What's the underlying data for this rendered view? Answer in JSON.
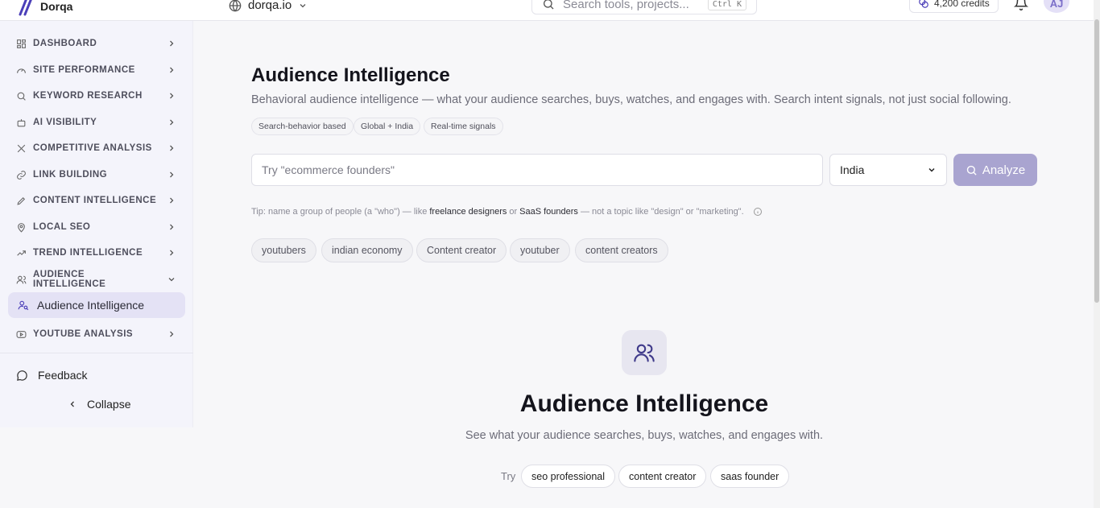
{
  "header": {
    "brand": "Dorqa",
    "site": "dorqa.io",
    "search_placeholder": "Search tools, projects...",
    "search_shortcut": "Ctrl K",
    "credits": "4,200 credits",
    "avatar_initials": "AJ"
  },
  "sidebar": {
    "items": [
      {
        "label": "DASHBOARD",
        "icon": "grid-icon"
      },
      {
        "label": "SITE PERFORMANCE",
        "icon": "gauge-icon"
      },
      {
        "label": "KEYWORD RESEARCH",
        "icon": "search-icon"
      },
      {
        "label": "AI VISIBILITY",
        "icon": "robot-icon"
      },
      {
        "label": "COMPETITIVE ANALYSIS",
        "icon": "swords-icon"
      },
      {
        "label": "LINK BUILDING",
        "icon": "link-icon"
      },
      {
        "label": "CONTENT INTELLIGENCE",
        "icon": "pen-icon"
      },
      {
        "label": "LOCAL SEO",
        "icon": "map-pin-icon"
      },
      {
        "label": "TREND INTELLIGENCE",
        "icon": "trending-up-icon"
      },
      {
        "label": "AUDIENCE INTELLIGENCE",
        "icon": "users-icon"
      },
      {
        "label": "YOUTUBE ANALYSIS",
        "icon": "youtube-icon"
      }
    ],
    "active_sub": "Audience Intelligence",
    "feedback": "Feedback",
    "collapse": "Collapse"
  },
  "main": {
    "title": "Audience Intelligence",
    "subtitle": "Behavioral audience intelligence — what your audience searches, buys, watches, and engages with. Search intent signals, not just social following.",
    "chips": [
      "Search-behavior based",
      "Global + India",
      "Real-time signals"
    ],
    "query_placeholder": "Try \"ecommerce founders\"",
    "country": "India",
    "analyze_label": "Analyze",
    "tip": {
      "p1": "Tip: name a group of people (a \"who\") — like",
      "b1": "freelance designers",
      "p2": "or",
      "b2": "SaaS founders",
      "p3": "— not a topic like \"design\" or \"marketing\"."
    },
    "recent_searches": [
      "youtubers",
      "indian economy",
      "Content creator",
      "youtuber",
      "content creators"
    ],
    "empty_title": "Audience Intelligence",
    "empty_sub": "See what your audience searches, buys, watches, and engages with.",
    "try_label": "Try",
    "try_chips": [
      "seo professional",
      "content creator",
      "saas founder"
    ]
  }
}
